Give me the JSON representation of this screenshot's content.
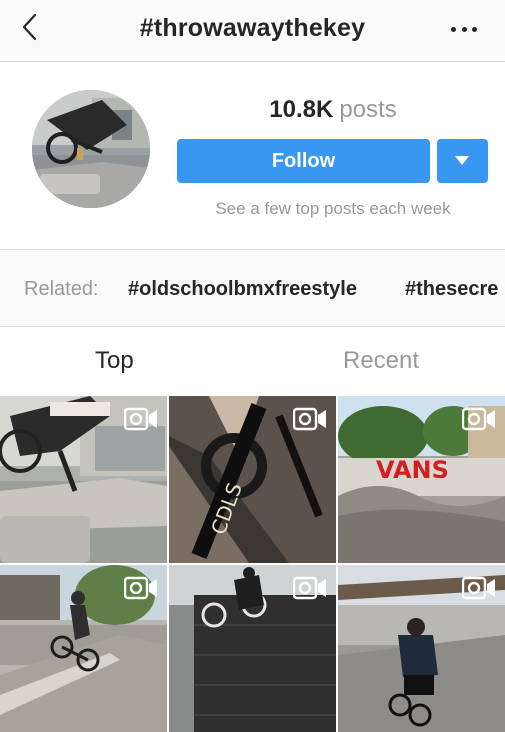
{
  "nav": {
    "title": "#throwawaythekey",
    "back_icon": "chevron-left-icon",
    "more_icon": "more-horizontal-icon"
  },
  "profile": {
    "posts_count": "10.8K",
    "posts_label": "posts",
    "follow_label": "Follow",
    "hint": "See a few top posts each week",
    "accent_color": "#3897f0"
  },
  "related": {
    "label": "Related:",
    "tags": [
      "#oldschoolbmxfreestyle",
      "#thesecre"
    ]
  },
  "tabs": {
    "top": "Top",
    "recent": "Recent",
    "selected": "Top"
  },
  "grid": {
    "items": [
      {
        "type": "video",
        "icon": "video-camera-icon"
      },
      {
        "type": "video",
        "icon": "video-camera-icon"
      },
      {
        "type": "video",
        "icon": "video-camera-icon",
        "sign_text": "VANS"
      },
      {
        "type": "video",
        "icon": "video-camera-icon"
      },
      {
        "type": "video",
        "icon": "video-camera-icon"
      },
      {
        "type": "video",
        "icon": "video-camera-icon"
      }
    ]
  }
}
